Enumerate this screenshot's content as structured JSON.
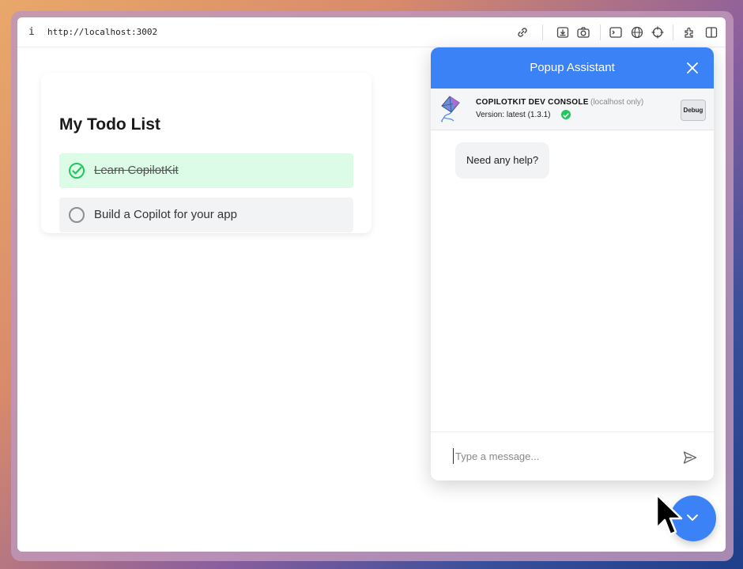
{
  "browser": {
    "info_glyph": "i",
    "url": "http://localhost:3002",
    "toolbar_icons": [
      "link-icon",
      "download-icon",
      "camera-icon",
      "terminal-icon",
      "globe-icon",
      "crosshair-icon",
      "extension-icon",
      "sidebar-icon"
    ]
  },
  "todo": {
    "title": "My Todo List",
    "items": [
      {
        "text": "Learn CopilotKit",
        "done": true
      },
      {
        "text": "Build a Copilot for your app",
        "done": false
      }
    ]
  },
  "popup": {
    "title": "Popup Assistant",
    "dev_console": {
      "title": "COPILOTKIT DEV CONSOLE",
      "host_note": "(localhost only)",
      "version": "Version: latest (1.3.1)",
      "debug_label": "Debug"
    },
    "messages": [
      {
        "role": "assistant",
        "text": "Need any help?"
      }
    ],
    "input_placeholder": "Type a message...",
    "input_value": ""
  },
  "colors": {
    "accent": "#3b82f6",
    "done_bg": "#dcfce7",
    "done_check": "#22c55e"
  }
}
